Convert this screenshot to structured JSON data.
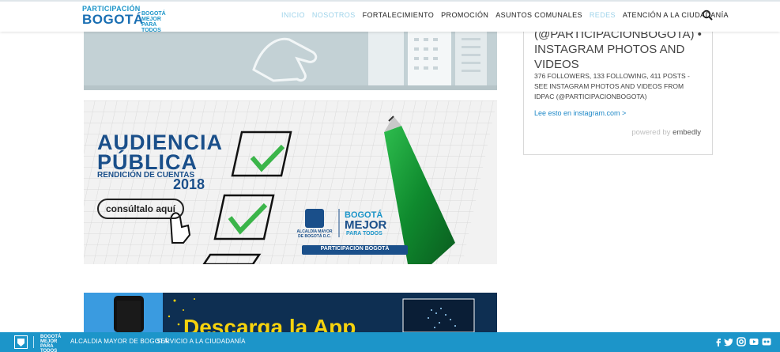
{
  "header": {
    "logo_top": "PARTICIPACIÓN",
    "logo_main": "BOGOTÁ",
    "logo_side": "BOGOTÁ MEJOR PARA TODOS",
    "nav": [
      {
        "label": "INICIO"
      },
      {
        "label": "NOSOTROS"
      },
      {
        "label": "FORTALECIMIENTO"
      },
      {
        "label": "PROMOCIÓN"
      },
      {
        "label": "ASUNTOS COMUNALES"
      },
      {
        "label": "REDES"
      },
      {
        "label": "ATENCIÓN A LA CIUDADANÍA"
      }
    ],
    "search_icon": "search-icon"
  },
  "banner2": {
    "title1": "AUDIENCIA",
    "title2": "PÚBLICA",
    "subtitle": "RENDICIÓN DE CUENTAS",
    "year": "2018",
    "cta": "consúltalo aquí",
    "alcaldia": "ALCALDÍA MAYOR DE BOGOTÁ D.C.",
    "bogota_small": "BOGOTÁ",
    "mejor": "MEJOR",
    "para_todos": "PARA TODOS",
    "participacion": "PARTICIPACIÓN BOGOTÁ"
  },
  "banner3": {
    "text": "Descarga la App"
  },
  "instagram": {
    "title": "(@PARTICIPACIONBOGOTA) • INSTAGRAM PHOTOS AND VIDEOS",
    "description": "376 FOLLOWERS, 133 FOLLOWING, 411 POSTS - SEE INSTAGRAM PHOTOS AND VIDEOS FROM IDPAC (@PARTICIPACIONBOGOTA)",
    "link": "Lee esto en instagram.com >",
    "powered_prefix": "powered by",
    "powered_brand": "embedly"
  },
  "footer": {
    "logo_text": "BOGOTÁ MEJOR PARA TODOS",
    "link1": "ALCALDIA MAYOR DE BOGOTÁ",
    "link2": "SERVICIO A LA CIUDADANÍA",
    "social": [
      "facebook-icon",
      "twitter-icon",
      "instagram-icon",
      "youtube-icon",
      "flickr-icon"
    ]
  },
  "colors": {
    "brand_blue": "#1c95c9",
    "dark_blue": "#1a6fb3",
    "green_check": "#3bb54a"
  }
}
